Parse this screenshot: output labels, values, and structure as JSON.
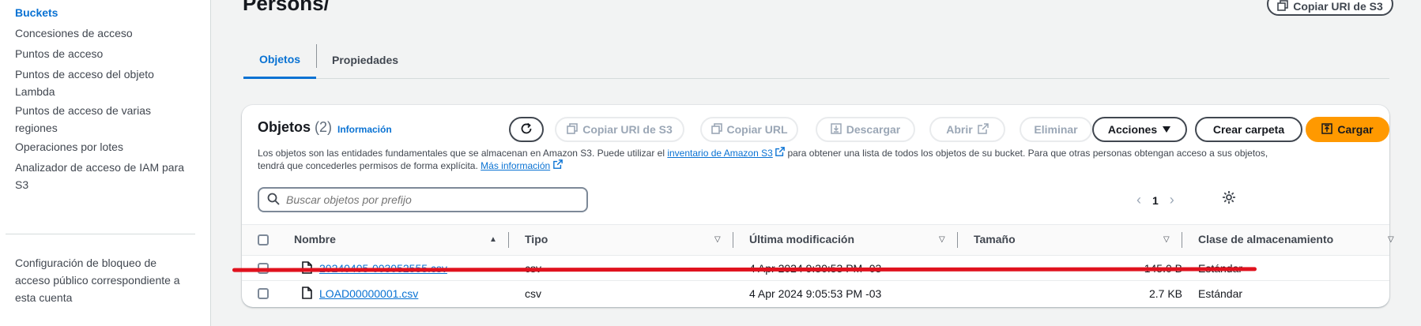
{
  "sidebar": {
    "items": [
      {
        "label": "Buckets",
        "active": true
      },
      {
        "label": "Concesiones de acceso"
      },
      {
        "label": "Puntos de acceso"
      },
      {
        "label": "Puntos de acceso del objeto Lambda"
      },
      {
        "label": "Puntos de acceso de varias regiones"
      },
      {
        "label": "Operaciones por lotes"
      },
      {
        "label": "Analizador de acceso de IAM para S3"
      },
      {
        "label": "Configuración de bloqueo de acceso público correspondiente a esta cuenta"
      }
    ]
  },
  "header": {
    "title": "Persons/",
    "copy_uri_label": "Copiar URI de S3"
  },
  "tabs": [
    {
      "label": "Objetos",
      "active": true
    },
    {
      "label": "Propiedades"
    }
  ],
  "objects_panel": {
    "title": "Objetos",
    "count": "(2)",
    "info_link": "Información",
    "description_part1": "Los objetos son las entidades fundamentales que se almacenan en Amazon S3. Puede utilizar el ",
    "description_link": "inventario de Amazon S3",
    "description_part2": " para obtener una lista de todos los objetos de su bucket. Para que otras personas obtengan acceso a sus objetos, tendrá que concederles permisos de forma explícita. ",
    "more_info_link": "Más información",
    "buttons": {
      "copy_uri": "Copiar URI de S3",
      "copy_url": "Copiar URL",
      "download": "Descargar",
      "open": "Abrir",
      "delete": "Eliminar",
      "actions": "Acciones",
      "create_folder": "Crear carpeta",
      "upload": "Cargar"
    },
    "search": {
      "placeholder": "Buscar objetos por prefijo",
      "value": ""
    },
    "pagination": {
      "current_page": "1"
    },
    "columns": [
      "Nombre",
      "Tipo",
      "Última modificación",
      "Tamaño",
      "Clase de almacenamiento"
    ],
    "rows": [
      {
        "name": "20240405-003052555.csv",
        "type": "csv",
        "modified": "4 Apr 2024 9:30:53 PM -03",
        "size": "145.0 B",
        "storage_class": "Estándar"
      },
      {
        "name": "LOAD00000001.csv",
        "type": "csv",
        "modified": "4 Apr 2024 9:05:53 PM -03",
        "size": "2.7 KB",
        "storage_class": "Estándar"
      }
    ]
  },
  "colors": {
    "link": "#0972d3",
    "primary_button": "#ff9900",
    "annotation_line": "#e0121e"
  }
}
